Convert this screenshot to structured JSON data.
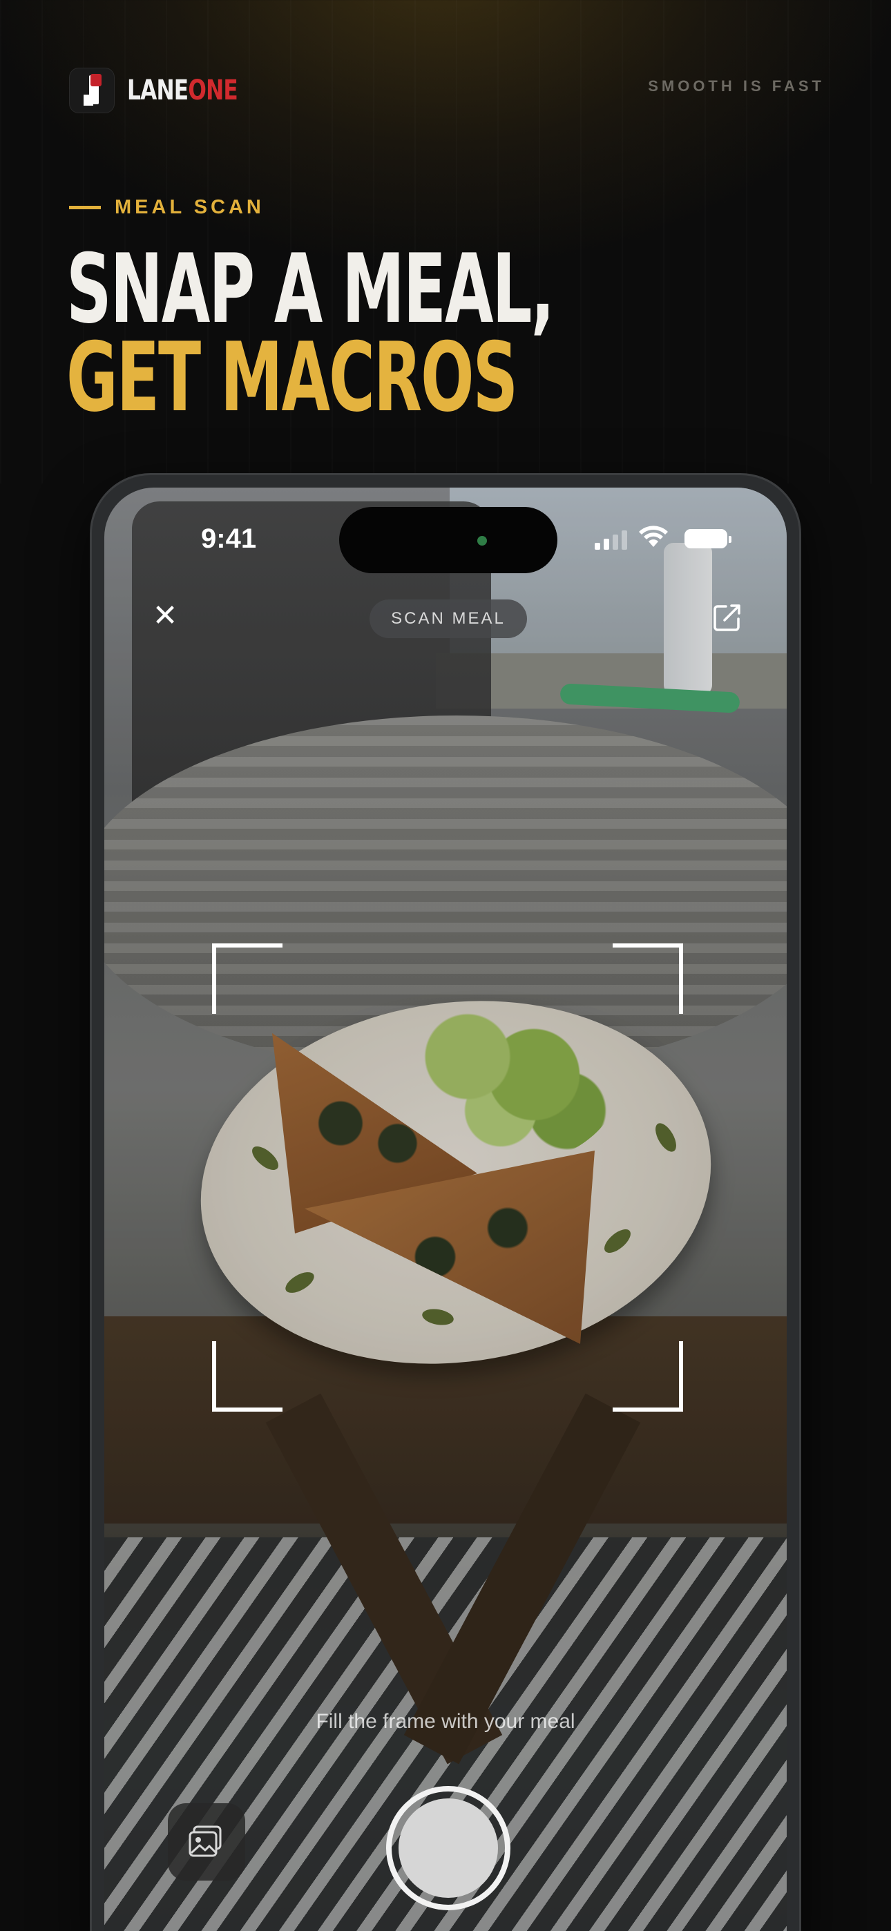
{
  "brand": {
    "name_part1": "LANE",
    "name_part2": "ONE",
    "tagline": "SMOOTH IS FAST"
  },
  "section": {
    "eyebrow": "MEAL SCAN"
  },
  "headline": {
    "line1": "SNAP A MEAL,",
    "line2": "GET MACROS"
  },
  "status_bar": {
    "time": "9:41"
  },
  "camera": {
    "close_icon": "close-icon",
    "mode_label": "SCAN MEAL",
    "edit_icon": "edit-icon",
    "hint": "Fill the frame with your meal",
    "gallery_icon": "gallery-icon",
    "shutter_icon": "shutter-button"
  },
  "colors": {
    "accent": "#e3b13b",
    "brand_red": "#d12a2e",
    "background": "#0b0b0b",
    "headline_white": "#f1efea"
  }
}
